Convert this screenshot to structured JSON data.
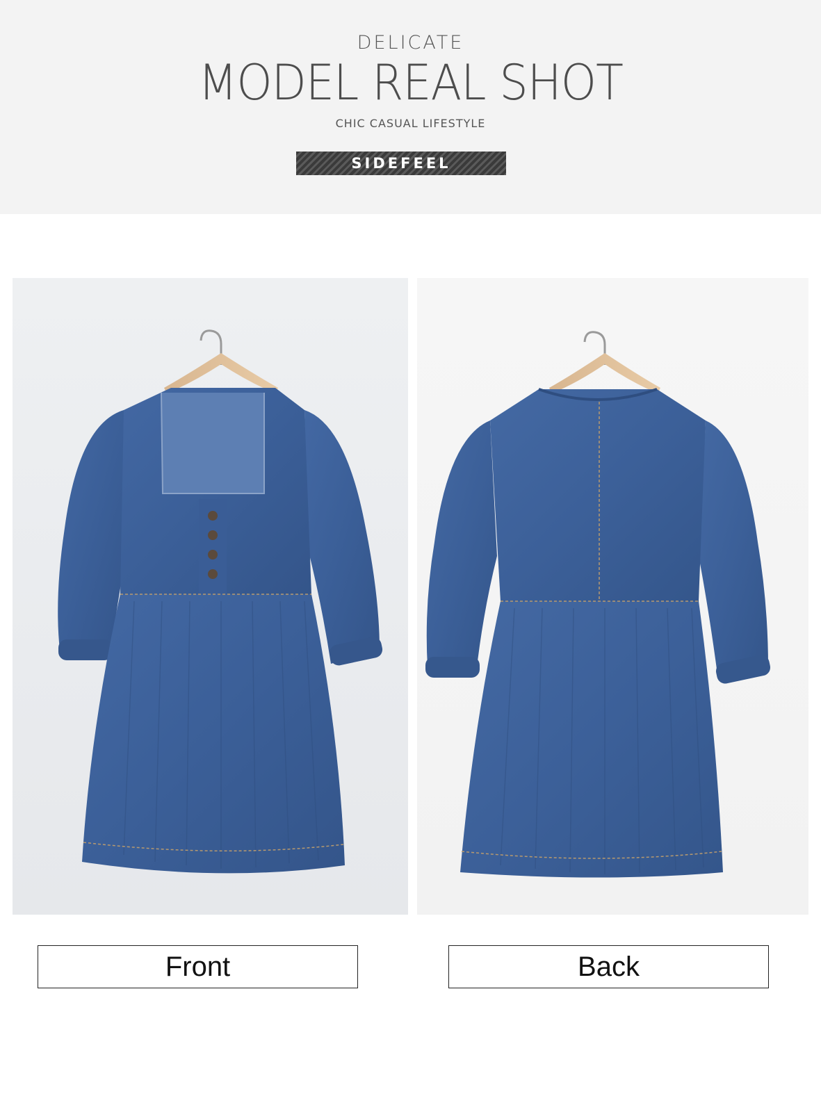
{
  "banner": {
    "kicker": "DELICATE",
    "title": "MODEL REAL SHOT",
    "tagline": "CHIC CASUAL LIFESTYLE",
    "brand": "SIDEFEEL"
  },
  "views": {
    "front_label": "Front",
    "back_label": "Back"
  },
  "colors": {
    "denim": "#3b5e96",
    "banner_bg": "#f3f3f3",
    "brand_bg": "#444444"
  }
}
